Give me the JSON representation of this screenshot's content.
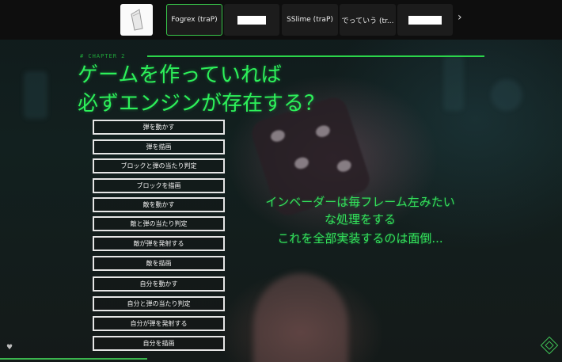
{
  "topbar": {
    "thumbnails": [
      {
        "label": ""
      },
      {
        "label": "Fogrex (traP)"
      },
      {
        "label": ""
      },
      {
        "label": "SSlime (traP)"
      },
      {
        "label": "でっていう (tr..."
      },
      {
        "label": ""
      }
    ],
    "next_label": "›"
  },
  "slide": {
    "chapter": "# CHAPTER 2",
    "title_line1": "ゲームを作っていれば",
    "title_line2": "必ずエンジンが存在する？",
    "process_items": [
      "弾を動かす",
      "弾を描画",
      "ブロックと弾の当たり判定",
      "ブロックを描画",
      "敵を動かす",
      "敵と弾の当たり判定",
      "敵が弾を発射する",
      "敵を描画",
      "自分を動かす",
      "自分と弾の当たり判定",
      "自分が弾を発射する",
      "自分を描画"
    ],
    "note_line1": "インベーダーは毎フレーム左みたい",
    "note_line2": "な処理をする",
    "note_line3": "これを全部実装するのは面倒..."
  },
  "footer": {
    "heart_glyph": "♥"
  },
  "colors": {
    "accent_green": "#2df05a",
    "active_border": "#38c84a"
  }
}
